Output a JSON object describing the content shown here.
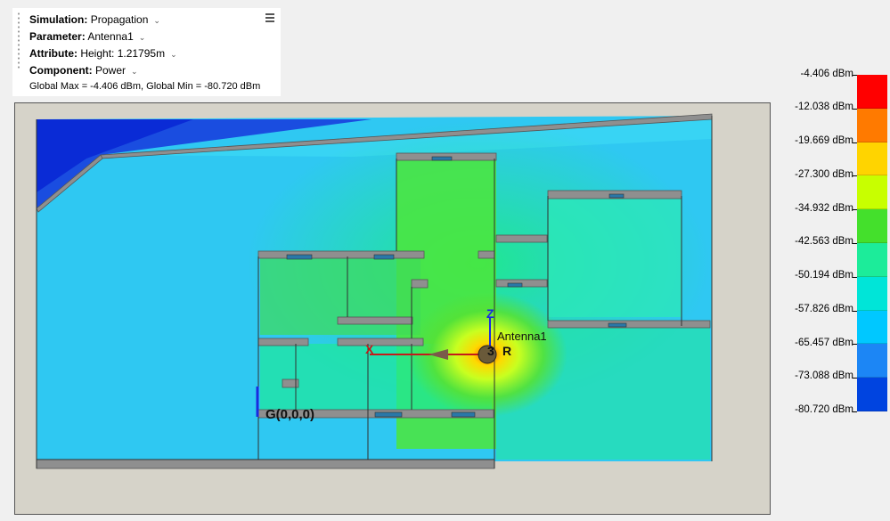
{
  "panel": {
    "simulation": {
      "label": "Simulation:",
      "value": "Propagation"
    },
    "parameter": {
      "label": "Parameter:",
      "value": "Antenna1"
    },
    "attribute": {
      "label": "Attribute:",
      "value": "Height: 1.21795m"
    },
    "component": {
      "label": "Component:",
      "value": "Power"
    },
    "summary": "Global Max = -4.406 dBm, Global Min = -80.720 dBm",
    "menu_icon": "hamburger-menu-icon",
    "dropdown_icon": "chevron-down-icon"
  },
  "scene": {
    "antenna_label": "Antenna1",
    "origin_label": "G(0,0,0)",
    "axis_x": "X",
    "axis_z": "Z",
    "axis_r": "R",
    "axis_3": "3",
    "colors": {
      "background": "#d6d3c9",
      "strong_signal": "#ff2a00",
      "mid_signal": "#3cdc2c",
      "weak_signal": "#24c6ff",
      "very_weak": "#0a2bd6",
      "walls": "#8f8f8f"
    }
  },
  "legend": {
    "labels": [
      "-4.406 dBm",
      "-12.038 dBm",
      "-19.669 dBm",
      "-27.300 dBm",
      "-34.932 dBm",
      "-42.563 dBm",
      "-50.194 dBm",
      "-57.826 dBm",
      "-65.457 dBm",
      "-73.088 dBm",
      "-80.720 dBm"
    ],
    "colors": [
      "#ff0000",
      "#ff7a00",
      "#ffd400",
      "#c8ff00",
      "#44e02c",
      "#1cec9a",
      "#00e5d8",
      "#00c8ff",
      "#1c86f5",
      "#0044e0"
    ]
  }
}
